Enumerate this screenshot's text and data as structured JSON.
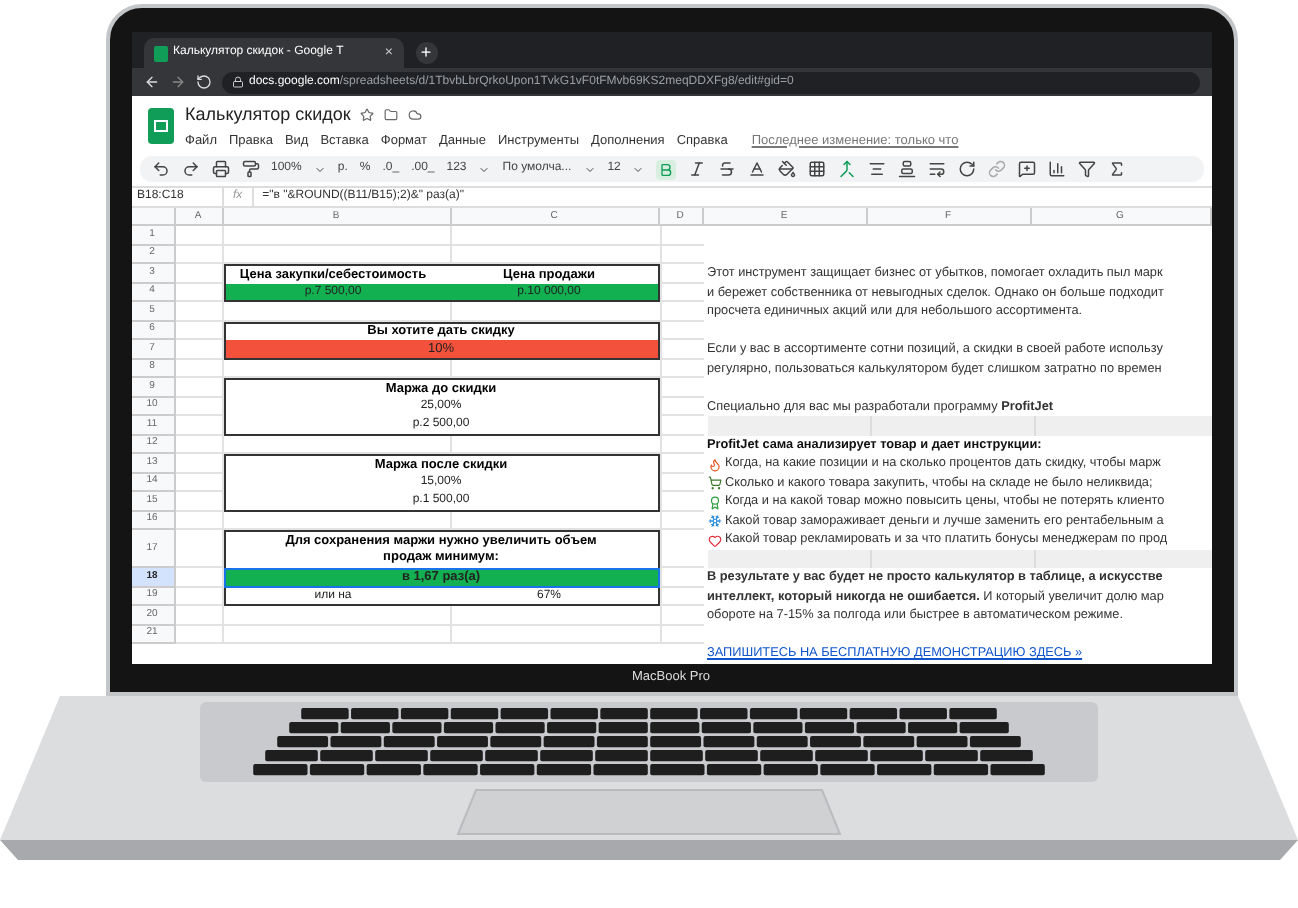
{
  "laptop": {
    "label": "MacBook Pro"
  },
  "browser": {
    "tab": {
      "title": "Калькулятор скидок - Google Т",
      "close": "×"
    },
    "new_tab": "+",
    "url_host": "docs.google.com",
    "url_path": "/spreadsheets/d/1TbvbLbrQrkoUpon1TvkG1vF0tFMvb69KS2meqDDXFg8/edit#gid=0"
  },
  "sheets": {
    "title": "Калькулятор скидок",
    "menu": [
      "Файл",
      "Правка",
      "Вид",
      "Вставка",
      "Формат",
      "Данные",
      "Инструменты",
      "Дополнения",
      "Справка"
    ],
    "last_edit": "Последнее изменение: только что",
    "toolbar": {
      "zoom": "100%",
      "currency": "р.",
      "percent": "%",
      "decrease_decimals": ".0_",
      "increase_decimals": ".00_",
      "format": "123",
      "font": "По умолча...",
      "font_size": "12"
    },
    "name_box": "B18:C18",
    "fx": "fx",
    "formula": "=\"в \"&ROUND((B11/B15);2)&\" раз(а)\"",
    "columns": [
      "A",
      "B",
      "C",
      "D",
      "E",
      "F",
      "G"
    ],
    "rows": [
      {
        "number": "1",
        "kind": "empty",
        "selected": false
      },
      {
        "number": "2",
        "kind": "empty",
        "selected": false
      },
      {
        "number": "3",
        "kind": "pair_header",
        "selected": false,
        "cells": [
          "Цена закупки/себестоимость",
          "Цена продажи"
        ]
      },
      {
        "number": "4",
        "kind": "pair_fill",
        "selected": false,
        "color": "#12b050",
        "cells": [
          "р.7 500,00",
          "р.10 000,00"
        ]
      },
      {
        "number": "5",
        "kind": "empty",
        "selected": false
      },
      {
        "number": "6",
        "kind": "title",
        "selected": false,
        "text": "Вы хотите дать скидку"
      },
      {
        "number": "7",
        "kind": "fill",
        "selected": false,
        "color": "#f4513d",
        "text": "10%"
      },
      {
        "number": "8",
        "kind": "empty",
        "selected": false
      },
      {
        "number": "9",
        "kind": "title",
        "selected": false,
        "text": "Маржа до скидки"
      },
      {
        "number": "10",
        "kind": "value",
        "selected": false,
        "text": "25,00%"
      },
      {
        "number": "11",
        "kind": "value",
        "selected": false,
        "text": "р.2 500,00"
      },
      {
        "number": "12",
        "kind": "empty",
        "selected": false
      },
      {
        "number": "13",
        "kind": "title",
        "selected": false,
        "text": "Маржа после скидки"
      },
      {
        "number": "14",
        "kind": "value",
        "selected": false,
        "text": "15,00%"
      },
      {
        "number": "15",
        "kind": "value",
        "selected": false,
        "text": "р.1 500,00"
      },
      {
        "number": "16",
        "kind": "empty",
        "selected": false
      },
      {
        "number": "17",
        "kind": "tall_title",
        "selected": false,
        "text": "Для сохранения маржи нужно увеличить объем продаж минимум:"
      },
      {
        "number": "18",
        "kind": "fill",
        "selected": true,
        "color": "#12b050",
        "text": "в 1,67 раз(а)"
      },
      {
        "number": "19",
        "kind": "pair",
        "selected": false,
        "cells": [
          "или на",
          "67%"
        ]
      },
      {
        "number": "20",
        "kind": "empty",
        "selected": false
      },
      {
        "number": "21",
        "kind": "empty",
        "selected": false
      }
    ],
    "notes": [
      {
        "kind": "blank"
      },
      {
        "kind": "blank"
      },
      {
        "kind": "text",
        "text": "Этот инструмент защищает бизнес от убытков, помогает охладить пыл марк"
      },
      {
        "kind": "text",
        "text": "и бережет собственника от невыгодных сделок. Однако он больше подходит"
      },
      {
        "kind": "text",
        "text": "просчета единичных акций или для небольшого ассортимента."
      },
      {
        "kind": "blank"
      },
      {
        "kind": "text",
        "text": "Если у вас в ассортименте сотни позиций, а скидки в своей работе использу"
      },
      {
        "kind": "text",
        "text": "регулярно, пользоваться калькулятором будет слишком затратно по времен"
      },
      {
        "kind": "blank"
      },
      {
        "kind": "text",
        "text": "Специально для вас мы разработали программу **ProfitJet**"
      },
      {
        "kind": "band"
      },
      {
        "kind": "heading",
        "text": "ProfitJet сама анализирует товар и дает инструкции:"
      },
      {
        "kind": "bullet",
        "text": "Когда, на какие позиции и на сколько процентов дать скидку, чтобы марж"
      },
      {
        "kind": "bullet",
        "text": "Сколько и какого товара закупить, чтобы на складе не было неликвида;"
      },
      {
        "kind": "bullet",
        "text": "Когда и на какой товар можно повысить цены, чтобы не потерять клиенто"
      },
      {
        "kind": "bullet",
        "text": "Какой товар замораживает деньги и лучше заменить его рентабельным а"
      },
      {
        "kind": "bullet",
        "text": "Какой товар рекламировать и за что платить бонусы менеджерам по прод"
      },
      {
        "kind": "band"
      },
      {
        "kind": "text",
        "text": "**В результате у вас будет не просто калькулятор в таблице, а искусстве**"
      },
      {
        "kind": "text",
        "text": "**интеллект, который никогда не ошибается.** И который увеличит долю мар"
      },
      {
        "kind": "text",
        "text": "обороте на 7-15% за полгода или быстрее в автоматическом режиме."
      },
      {
        "kind": "blank"
      },
      {
        "kind": "link",
        "text": "ЗАПИШИТЕСЬ НА БЕСПЛАТНУЮ ДЕМОНСТРАЦИЮ ЗДЕСЬ »"
      }
    ]
  }
}
